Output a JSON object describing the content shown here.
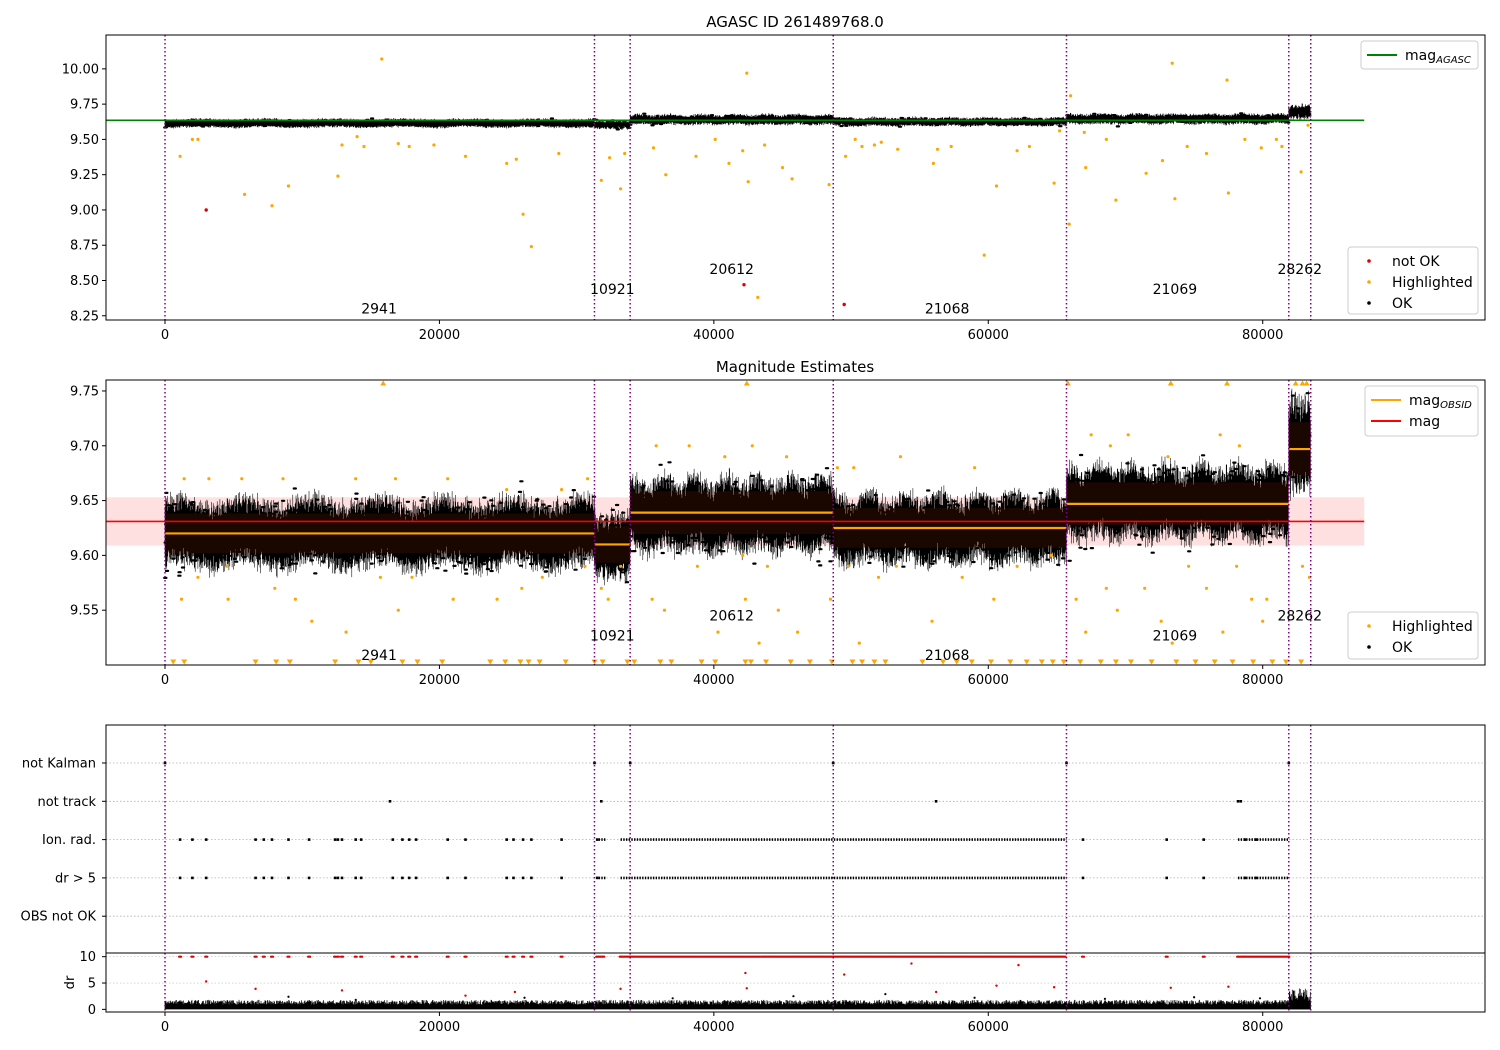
{
  "chart_data": [
    {
      "type": "scatter",
      "title": "AGASC ID 261489768.0",
      "xlim": [
        -4300,
        96200
      ],
      "ylim": [
        8.22,
        10.24
      ],
      "xticks": [
        0,
        20000,
        40000,
        60000,
        80000
      ],
      "yticks": [
        8.25,
        8.5,
        8.75,
        9.0,
        9.25,
        9.5,
        9.75,
        10.0
      ],
      "ytick_labels": [
        "8.25",
        "8.50",
        "8.75",
        "9.00",
        "9.25",
        "9.50",
        "9.75",
        "10.00"
      ],
      "hline": {
        "y": 9.635,
        "x_range": [
          -4300,
          87400
        ],
        "color": "#008000",
        "label": "mag",
        "label_sub": "AGASC"
      },
      "obs_boundaries": [
        0,
        31300,
        33900,
        48700,
        65700,
        81900,
        83500
      ],
      "obs_labels": [
        {
          "text": "2941",
          "x": 15600,
          "y": 8.3
        },
        {
          "text": "10921",
          "x": 32600,
          "y": 8.44
        },
        {
          "text": "20612",
          "x": 41300,
          "y": 8.58
        },
        {
          "text": "21068",
          "x": 57000,
          "y": 8.3
        },
        {
          "text": "21069",
          "x": 73600,
          "y": 8.44
        },
        {
          "text": "28262",
          "x": 82700,
          "y": 8.58
        }
      ],
      "band_segments": [
        {
          "x": [
            0,
            31300
          ],
          "mean": 9.615,
          "halfwidth": 0.025
        },
        {
          "x": [
            31300,
            33900
          ],
          "mean": 9.605,
          "halfwidth": 0.025
        },
        {
          "x": [
            33900,
            48700
          ],
          "mean": 9.64,
          "halfwidth": 0.03
        },
        {
          "x": [
            48700,
            65700
          ],
          "mean": 9.625,
          "halfwidth": 0.025
        },
        {
          "x": [
            65700,
            81900
          ],
          "mean": 9.645,
          "halfwidth": 0.03
        },
        {
          "x": [
            81900,
            83500
          ],
          "mean": 9.695,
          "halfwidth": 0.04
        }
      ],
      "highlighted": [
        [
          1100,
          9.38
        ],
        [
          2000,
          9.5
        ],
        [
          2400,
          9.5
        ],
        [
          5800,
          9.11
        ],
        [
          7800,
          9.03
        ],
        [
          9000,
          9.17
        ],
        [
          12600,
          9.24
        ],
        [
          12900,
          9.46
        ],
        [
          14000,
          9.52
        ],
        [
          14500,
          9.45
        ],
        [
          15800,
          10.07
        ],
        [
          17000,
          9.47
        ],
        [
          17800,
          9.45
        ],
        [
          19600,
          9.46
        ],
        [
          21900,
          9.38
        ],
        [
          24900,
          9.33
        ],
        [
          25600,
          9.36
        ],
        [
          26100,
          8.97
        ],
        [
          26700,
          8.74
        ],
        [
          28700,
          9.4
        ],
        [
          31800,
          9.21
        ],
        [
          32400,
          9.37
        ],
        [
          33200,
          9.15
        ],
        [
          33500,
          9.4
        ],
        [
          35600,
          9.44
        ],
        [
          36500,
          9.25
        ],
        [
          38700,
          9.38
        ],
        [
          40100,
          9.5
        ],
        [
          41100,
          9.33
        ],
        [
          42100,
          9.42
        ],
        [
          42400,
          9.97
        ],
        [
          42500,
          9.2
        ],
        [
          43200,
          8.38
        ],
        [
          43700,
          9.46
        ],
        [
          45000,
          9.3
        ],
        [
          45700,
          9.22
        ],
        [
          48400,
          9.18
        ],
        [
          49600,
          9.38
        ],
        [
          50300,
          9.5
        ],
        [
          50800,
          9.45
        ],
        [
          51700,
          9.46
        ],
        [
          52200,
          9.48
        ],
        [
          53400,
          9.43
        ],
        [
          56000,
          9.33
        ],
        [
          56300,
          9.43
        ],
        [
          57300,
          9.45
        ],
        [
          59700,
          8.68
        ],
        [
          60600,
          9.17
        ],
        [
          62100,
          9.42
        ],
        [
          63000,
          9.45
        ],
        [
          64800,
          9.19
        ],
        [
          65200,
          9.56
        ],
        [
          65900,
          8.9
        ],
        [
          66000,
          9.81
        ],
        [
          67000,
          9.55
        ],
        [
          67100,
          9.3
        ],
        [
          68600,
          9.5
        ],
        [
          69300,
          9.07
        ],
        [
          71500,
          9.26
        ],
        [
          72700,
          9.35
        ],
        [
          73400,
          10.04
        ],
        [
          73600,
          9.08
        ],
        [
          74500,
          9.45
        ],
        [
          75900,
          9.4
        ],
        [
          77400,
          9.92
        ],
        [
          77500,
          9.12
        ],
        [
          78700,
          9.5
        ],
        [
          79900,
          9.44
        ],
        [
          81000,
          9.5
        ],
        [
          81400,
          9.45
        ],
        [
          82800,
          9.27
        ],
        [
          83300,
          9.6
        ]
      ],
      "not_ok": [
        [
          3000,
          9.0
        ],
        [
          42200,
          8.47
        ],
        [
          49500,
          8.33
        ]
      ],
      "legends": [
        {
          "entries": [
            {
              "label": "mag",
              "label_sub": "AGASC",
              "kind": "line",
              "color": "#008000"
            }
          ]
        },
        {
          "entries": [
            {
              "label": "not OK",
              "kind": "point",
              "color": "#e00000"
            },
            {
              "label": "Highlighted",
              "kind": "point",
              "color": "#ffa500"
            },
            {
              "label": "OK",
              "kind": "point",
              "color": "#000000"
            }
          ]
        }
      ]
    },
    {
      "type": "scatter",
      "title": "Magnitude Estimates",
      "xlim": [
        -4300,
        96200
      ],
      "ylim": [
        9.5,
        9.76
      ],
      "xticks": [
        0,
        20000,
        40000,
        60000,
        80000
      ],
      "yticks": [
        9.55,
        9.6,
        9.65,
        9.7,
        9.75
      ],
      "ytick_labels": [
        "9.55",
        "9.60",
        "9.65",
        "9.70",
        "9.75"
      ],
      "mag_line": {
        "y": 9.631,
        "band": [
          9.609,
          9.653
        ],
        "x_range": [
          -4300,
          87400
        ],
        "color": "#ff0000",
        "label": "mag"
      },
      "obsid_segments": [
        {
          "x": [
            0,
            31300
          ],
          "mag": 9.62,
          "mean": 9.62,
          "halfwidth": 0.026
        },
        {
          "x": [
            31300,
            33900
          ],
          "mag": 9.61,
          "mean": 9.608,
          "halfwidth": 0.024
        },
        {
          "x": [
            33900,
            48700
          ],
          "mag": 9.639,
          "mean": 9.637,
          "halfwidth": 0.028
        },
        {
          "x": [
            48700,
            65700
          ],
          "mag": 9.625,
          "mean": 9.624,
          "halfwidth": 0.026
        },
        {
          "x": [
            65700,
            81900
          ],
          "mag": 9.647,
          "mean": 9.648,
          "halfwidth": 0.028
        },
        {
          "x": [
            81900,
            83500
          ],
          "mag": 9.697,
          "mean": 9.7,
          "halfwidth": 0.035
        }
      ],
      "obsid_label": "mag",
      "obsid_label_sub": "OBSID",
      "obs_boundaries": [
        0,
        31300,
        33900,
        48700,
        65700,
        81900,
        83500
      ],
      "obs_labels": [
        {
          "text": "2941",
          "x": 15600,
          "y": 9.509
        },
        {
          "text": "10921",
          "x": 32600,
          "y": 9.527
        },
        {
          "text": "20612",
          "x": 41300,
          "y": 9.545
        },
        {
          "text": "21068",
          "x": 57000,
          "y": 9.509
        },
        {
          "text": "21069",
          "x": 73600,
          "y": 9.527
        },
        {
          "text": "28262",
          "x": 82700,
          "y": 9.545
        }
      ],
      "highlighted": [
        [
          1200,
          9.56
        ],
        [
          2400,
          9.58
        ],
        [
          4500,
          9.59
        ],
        [
          4600,
          9.56
        ],
        [
          8000,
          9.57
        ],
        [
          9500,
          9.56
        ],
        [
          10700,
          9.54
        ],
        [
          13200,
          9.53
        ],
        [
          15700,
          9.58
        ],
        [
          17000,
          9.55
        ],
        [
          18000,
          9.58
        ],
        [
          21000,
          9.56
        ],
        [
          24200,
          9.56
        ],
        [
          26000,
          9.57
        ],
        [
          27500,
          9.58
        ],
        [
          30600,
          9.59
        ],
        [
          31800,
          9.57
        ],
        [
          32300,
          9.56
        ],
        [
          33200,
          9.59
        ],
        [
          35500,
          9.56
        ],
        [
          36400,
          9.55
        ],
        [
          38800,
          9.59
        ],
        [
          40300,
          9.53
        ],
        [
          42100,
          9.6
        ],
        [
          42300,
          9.56
        ],
        [
          43300,
          9.52
        ],
        [
          43900,
          9.59
        ],
        [
          44700,
          9.55
        ],
        [
          46100,
          9.53
        ],
        [
          48500,
          9.56
        ],
        [
          49800,
          9.59
        ],
        [
          50600,
          9.52
        ],
        [
          52000,
          9.58
        ],
        [
          53300,
          9.59
        ],
        [
          55900,
          9.54
        ],
        [
          58100,
          9.58
        ],
        [
          60400,
          9.56
        ],
        [
          62100,
          9.59
        ],
        [
          64600,
          9.6
        ],
        [
          66400,
          9.56
        ],
        [
          67100,
          9.53
        ],
        [
          68600,
          9.57
        ],
        [
          69400,
          9.55
        ],
        [
          71400,
          9.57
        ],
        [
          72600,
          9.54
        ],
        [
          73400,
          9.52
        ],
        [
          74600,
          9.59
        ],
        [
          75900,
          9.57
        ],
        [
          77100,
          9.53
        ],
        [
          78100,
          9.59
        ],
        [
          79200,
          9.56
        ],
        [
          80000,
          9.54
        ],
        [
          80300,
          9.56
        ],
        [
          82900,
          9.59
        ],
        [
          83400,
          9.58
        ],
        [
          35800,
          9.7
        ],
        [
          38200,
          9.7
        ],
        [
          40800,
          9.69
        ],
        [
          42800,
          9.7
        ],
        [
          45300,
          9.69
        ],
        [
          49000,
          9.68
        ],
        [
          50200,
          9.68
        ],
        [
          53600,
          9.69
        ],
        [
          59000,
          9.68
        ],
        [
          67500,
          9.71
        ],
        [
          68900,
          9.7
        ],
        [
          70200,
          9.71
        ],
        [
          73100,
          9.69
        ],
        [
          76900,
          9.71
        ],
        [
          78300,
          9.7
        ],
        [
          1400,
          9.67
        ],
        [
          3200,
          9.67
        ],
        [
          5600,
          9.67
        ],
        [
          8600,
          9.67
        ],
        [
          13900,
          9.67
        ],
        [
          16800,
          9.67
        ],
        [
          20600,
          9.67
        ],
        [
          24900,
          9.66
        ],
        [
          28900,
          9.66
        ],
        [
          30800,
          9.67
        ]
      ],
      "clip_top_x": [
        15900,
        42400,
        65800,
        73300,
        77400,
        82400,
        82900,
        83200
      ],
      "clip_bottom_x": [
        600,
        1400,
        6600,
        8100,
        9100,
        12400,
        14100,
        15000,
        17300,
        18400,
        20200,
        23700,
        24800,
        25900,
        26500,
        27300,
        29200,
        31300,
        31900,
        33700,
        34200,
        36100,
        36900,
        39100,
        40100,
        42300,
        42700,
        43800,
        45600,
        47000,
        48600,
        50100,
        50800,
        51700,
        52500,
        55200,
        56700,
        57700,
        58800,
        60200,
        61600,
        62800,
        63900,
        64700,
        65500,
        66700,
        68200,
        69300,
        70400,
        71900,
        73700,
        75100,
        76500,
        77800,
        79300,
        80700,
        81700,
        82800
      ],
      "legends": [
        {
          "entries": [
            {
              "label": "mag",
              "label_sub": "OBSID",
              "kind": "line",
              "color": "#ffa500"
            },
            {
              "label": "mag",
              "kind": "line",
              "color": "#ff0000"
            }
          ]
        },
        {
          "entries": [
            {
              "label": "Highlighted",
              "kind": "point",
              "color": "#ffa500"
            },
            {
              "label": "OK",
              "kind": "point",
              "color": "#000000"
            }
          ]
        }
      ]
    },
    {
      "type": "scatter",
      "title": "",
      "xlim": [
        -4300,
        96200
      ],
      "xticks": [
        0,
        20000,
        40000,
        60000,
        80000
      ],
      "flag_rows": [
        "not Kalman",
        "not track",
        "Ion. rad.",
        "dr > 5",
        "OBS not OK"
      ],
      "obs_boundaries": [
        0,
        31300,
        33900,
        48700,
        65700,
        81900,
        83500
      ],
      "not_kalman_x": [
        0,
        31300,
        33900,
        48700,
        65700,
        81900
      ],
      "not_track_x": [
        16400,
        31800,
        56200,
        78200,
        78400
      ],
      "flag_sparse_x": [
        1100,
        2000,
        3000,
        6600,
        7200,
        7800,
        9000,
        10500,
        12400,
        12600,
        12900,
        13900,
        14300,
        16600,
        17300,
        17800,
        18300,
        20600,
        21900,
        24900,
        25400,
        26100,
        26700,
        28900,
        31500,
        66900,
        73000,
        75700,
        78700,
        79500
      ],
      "flag_dense_ranges": [
        [
          31600,
          32100
        ],
        [
          33200,
          65700
        ],
        [
          78200,
          81900
        ]
      ],
      "dr_ylim": [
        -0.5,
        10.7
      ],
      "dr_yticks": [
        0,
        5,
        10
      ],
      "dr_ytick_labels": [
        "0",
        "5",
        "10"
      ],
      "dr_ylabel": "dr"
    }
  ]
}
